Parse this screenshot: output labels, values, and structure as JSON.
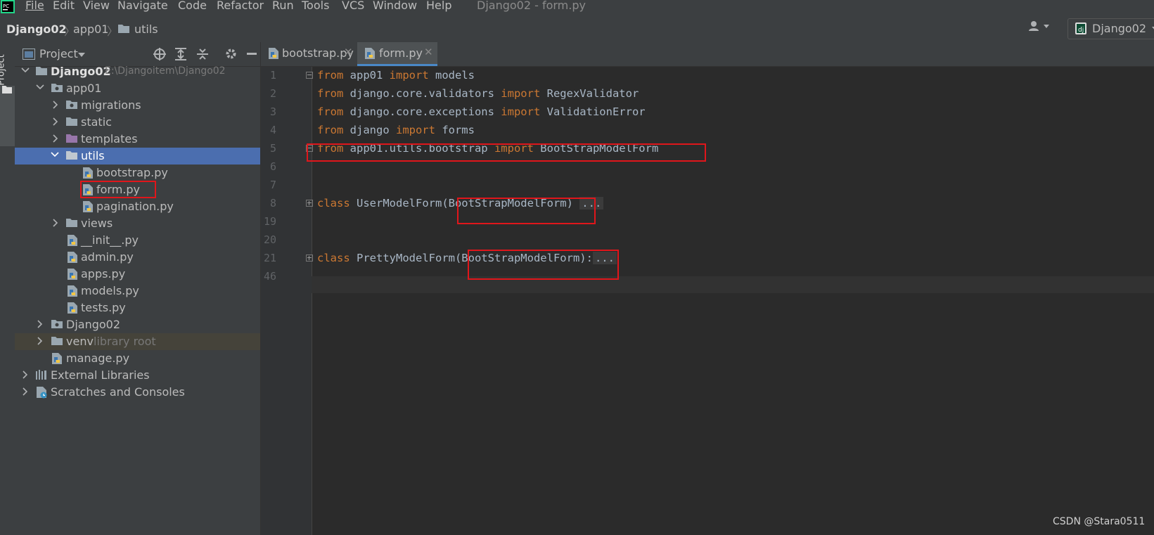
{
  "menubar": {
    "items": [
      "File",
      "Edit",
      "View",
      "Navigate",
      "Code",
      "Refactor",
      "Run",
      "Tools",
      "VCS",
      "Window",
      "Help"
    ],
    "window_title": "Django02 - form.py"
  },
  "breadcrumb": {
    "items": [
      "Django02",
      "app01",
      "utils"
    ]
  },
  "run_config": {
    "label": "Django02"
  },
  "left_strip": {
    "label": "Project"
  },
  "project_panel": {
    "title": "Project",
    "tree": [
      {
        "label": "Django02",
        "suffix": "E:\\Djangoitem\\Django02"
      },
      {
        "label": "app01"
      },
      {
        "label": "migrations"
      },
      {
        "label": "static"
      },
      {
        "label": "templates"
      },
      {
        "label": "utils"
      },
      {
        "label": "bootstrap.py"
      },
      {
        "label": "form.py"
      },
      {
        "label": "pagination.py"
      },
      {
        "label": "views"
      },
      {
        "label": "__init__.py"
      },
      {
        "label": "admin.py"
      },
      {
        "label": "apps.py"
      },
      {
        "label": "models.py"
      },
      {
        "label": "tests.py"
      },
      {
        "label": "Django02"
      },
      {
        "label": "venv",
        "suffix": "library root"
      },
      {
        "label": "manage.py"
      },
      {
        "label": "External Libraries"
      },
      {
        "label": "Scratches and Consoles"
      }
    ]
  },
  "tabs": [
    {
      "label": "bootstrap.py"
    },
    {
      "label": "form.py"
    }
  ],
  "editor": {
    "line_numbers": [
      "1",
      "2",
      "3",
      "4",
      "5",
      "6",
      "7",
      "8",
      "19",
      "20",
      "21",
      "46"
    ],
    "lines": [
      {
        "k1": "from",
        "t1": " app01 ",
        "k2": "import",
        "t2": " models"
      },
      {
        "k1": "from",
        "t1": " django.core.validators ",
        "k2": "import",
        "t2": " RegexValidator"
      },
      {
        "k1": "from",
        "t1": " django.core.exceptions ",
        "k2": "import",
        "t2": " ValidationError"
      },
      {
        "k1": "from",
        "t1": " django ",
        "k2": "import",
        "t2": " forms"
      },
      {
        "k1": "from",
        "t1": " app01.utils.bootstrap ",
        "k2": "import",
        "t2": " BootStrapModelForm"
      },
      {
        "k1": "class",
        "t1": " UserModelForm(BootStrapModelForm)",
        "fold": "..."
      },
      {
        "k1": "class",
        "t1": " PrettyModelForm(BootStrapModelForm):",
        "fold": "..."
      }
    ]
  },
  "watermark": "CSDN @Stara0511",
  "colors": {
    "highlight_box": "#e0161b",
    "keyword": "#cc7832",
    "selection": "#4b6eaf"
  }
}
